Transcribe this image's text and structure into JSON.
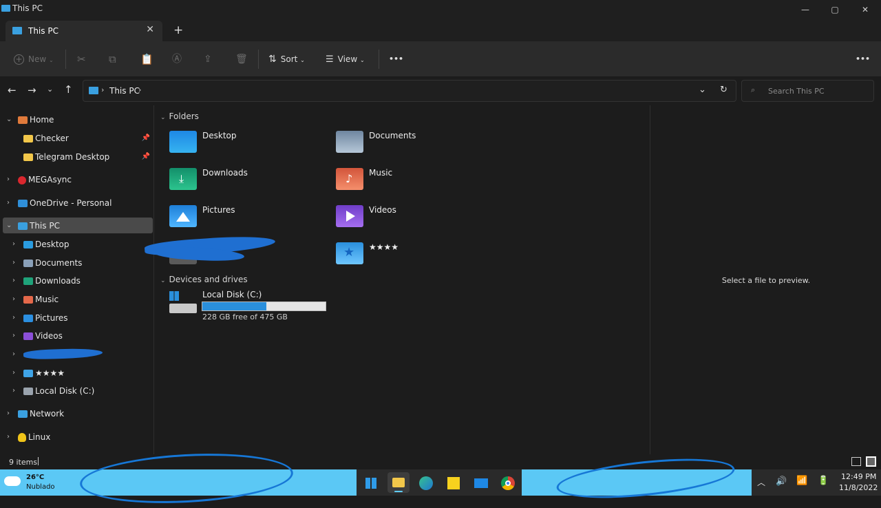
{
  "window": {
    "title": "This PC",
    "minimize": "—",
    "maximize": "▢",
    "close": "✕"
  },
  "tab": {
    "label": "This PC",
    "close": "✕",
    "new": "+"
  },
  "toolbar": {
    "new_label": "New",
    "sort_label": "Sort",
    "view_label": "View",
    "more": "•••"
  },
  "address": {
    "crumb": "This PC",
    "search_placeholder": "Search This PC"
  },
  "nav": {
    "home": "Home",
    "checker": "Checker",
    "telegram": "Telegram Desktop",
    "mega": "MEGAsync",
    "onedrive": "OneDrive - Personal",
    "thispc": "This PC",
    "desktop": "Desktop",
    "documents": "Documents",
    "downloads": "Downloads",
    "music": "Music",
    "pictures": "Pictures",
    "videos": "Videos",
    "stars": "★★★★",
    "localdisk": "Local Disk (C:)",
    "network": "Network",
    "linux": "Linux"
  },
  "main": {
    "folders_header": "Folders",
    "folders": [
      "Desktop",
      "Documents",
      "Downloads",
      "Music",
      "Pictures",
      "Videos",
      "★★★★"
    ],
    "drives_header": "Devices and drives",
    "drive_name": "Local Disk (C:)",
    "drive_free": "228 GB free of 475 GB",
    "drive_used_fraction": 0.52
  },
  "preview": {
    "text": "Select a file to preview."
  },
  "status": {
    "items": "9 items"
  },
  "taskbar": {
    "temp": "26°C",
    "weather": "Nublado",
    "time": "12:49 PM",
    "date": "11/8/2022"
  },
  "colors": {
    "accent": "#0078d4",
    "taskbar": "#5bc8f5",
    "selection": "#4a4a4a"
  }
}
